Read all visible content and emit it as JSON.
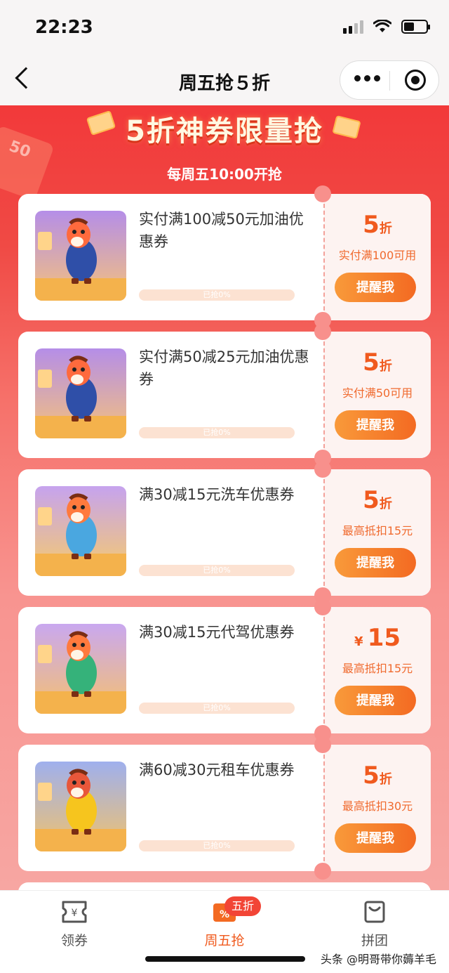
{
  "status_bar": {
    "time": "22:23"
  },
  "nav": {
    "title": "周五抢５折"
  },
  "banner": {
    "title": "5折神券限量抢",
    "subtitle": "每周五10:00开抢",
    "badge_text": "50"
  },
  "coupons": [
    {
      "title": "实付满100减50元加油优惠券",
      "discount_value": "5",
      "discount_unit": "折",
      "discount_prefix": "",
      "condition": "实付满100可用",
      "progress_label": "已抢0%",
      "progress": 0,
      "button_label": "提醒我",
      "image": "horse-fuel-pump"
    },
    {
      "title": "实付满50减25元加油优惠券",
      "discount_value": "5",
      "discount_unit": "折",
      "discount_prefix": "",
      "condition": "实付满50可用",
      "progress_label": "已抢0%",
      "progress": 0,
      "button_label": "提醒我",
      "image": "horse-fuel-pump"
    },
    {
      "title": "满30减15元洗车优惠券",
      "discount_value": "5",
      "discount_unit": "折",
      "discount_prefix": "",
      "condition": "最高抵扣15元",
      "progress_label": "已抢0%",
      "progress": 0,
      "button_label": "提醒我",
      "image": "horse-car-wash"
    },
    {
      "title": "满30减15元代驾优惠券",
      "discount_value": "15",
      "discount_unit": "",
      "discount_prefix": "¥",
      "condition": "最高抵扣15元",
      "progress_label": "已抢0%",
      "progress": 0,
      "button_label": "提醒我",
      "image": "horse-scooter"
    },
    {
      "title": "满60减30元租车优惠券",
      "discount_value": "5",
      "discount_unit": "折",
      "discount_prefix": "",
      "condition": "最高抵扣30元",
      "progress_label": "已抢0%",
      "progress": 0,
      "button_label": "提醒我",
      "image": "horse-convertible"
    }
  ],
  "tabs": [
    {
      "label": "领券",
      "icon": "coupon-icon",
      "active": false
    },
    {
      "label": "周五抢",
      "icon": "friday-deal-icon",
      "active": true,
      "badge": "五折"
    },
    {
      "label": "拼团",
      "icon": "bag-icon",
      "active": false
    }
  ],
  "watermark": "头条 @明哥带你薅羊毛",
  "colors": {
    "accent": "#f05a1e",
    "banner_red": "#f2393a",
    "button_orange": "#f36a22"
  }
}
